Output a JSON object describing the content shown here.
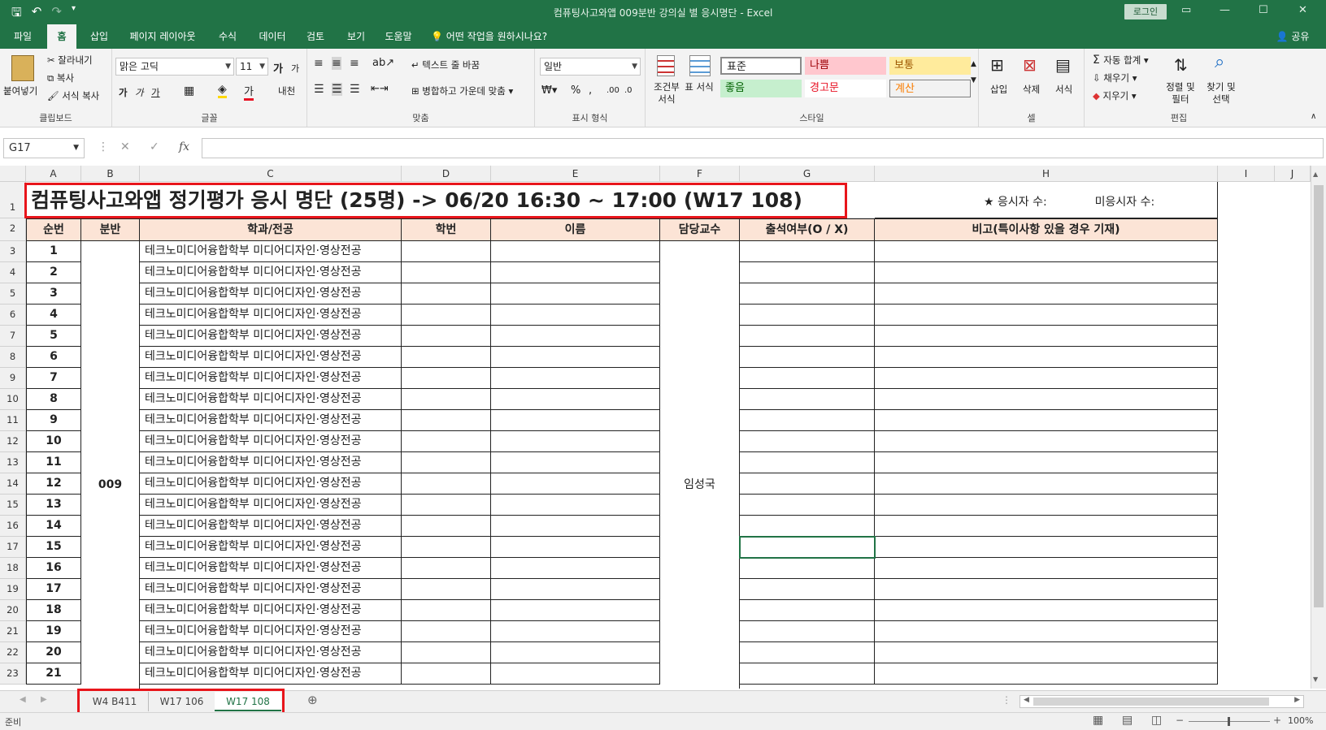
{
  "window": {
    "title": "컴퓨팅사고와앱 009분반 강의실 별 응시명단  -  Excel",
    "login_label": "로그인"
  },
  "ribbon_tabs": [
    "파일",
    "홈",
    "삽입",
    "페이지 레이아웃",
    "수식",
    "데이터",
    "검토",
    "보기",
    "도움말"
  ],
  "tell_me": "어떤 작업을 원하시나요?",
  "share_label": "공유",
  "ribbon": {
    "clipboard": {
      "paste": "붙여넣기",
      "cut": "잘라내기",
      "copy": "복사",
      "format_painter": "서식 복사",
      "label": "클립보드"
    },
    "font": {
      "name": "맑은 고딕",
      "size": "11",
      "label": "글꼴"
    },
    "alignment": {
      "wrap": "텍스트 줄 바꿈",
      "merge": "병합하고 가운데 맞춤",
      "label": "맞춤"
    },
    "number": {
      "format": "일반",
      "label": "표시 형식"
    },
    "styles": {
      "conditional": "조건부 서식",
      "table": "표 서식",
      "normal": "표준",
      "bad": "나쁨",
      "neutral": "보통",
      "good": "좋음",
      "warning": "경고문",
      "calculation": "계산",
      "label": "스타일"
    },
    "cells": {
      "insert": "삽입",
      "delete": "삭제",
      "format": "서식",
      "label": "셀"
    },
    "editing": {
      "autosum": "자동 합계",
      "fill": "채우기",
      "clear": "지우기",
      "sort": "정렬 및 필터",
      "find": "찾기 및 선택",
      "label": "편집"
    }
  },
  "formula_bar": {
    "name_box": "G17",
    "fx": "fx",
    "value": ""
  },
  "columns": [
    "A",
    "B",
    "C",
    "D",
    "E",
    "F",
    "G",
    "H",
    "I",
    "J"
  ],
  "sheet": {
    "title": "컴퓨팅사고와앱 정기평가 응시 명단 (25명) -> 06/20 16:30 ~ 17:00  (W17 108)",
    "examinees_label": "★ 응시자 수:",
    "non_examinees_label": "미응시자 수:",
    "headers": [
      "순번",
      "분반",
      "학과/전공",
      "학번",
      "이름",
      "담당교수",
      "출석여부(O / X)",
      "비고(특이사항 있을 경우 기재)"
    ],
    "section": "009",
    "professor": "임성국",
    "major": "테크노미디어융합학부 미디어디자인·영상전공",
    "row_numbers": [
      "1",
      "2",
      "3",
      "4",
      "5",
      "6",
      "7",
      "8",
      "9",
      "10",
      "11",
      "12",
      "13",
      "14",
      "15",
      "16",
      "17",
      "18",
      "19",
      "20",
      "21",
      "22",
      "23"
    ],
    "seq": [
      "1",
      "2",
      "3",
      "4",
      "5",
      "6",
      "7",
      "8",
      "9",
      "10",
      "11",
      "12",
      "13",
      "14",
      "15",
      "16",
      "17",
      "18",
      "19",
      "20",
      "21"
    ]
  },
  "sheet_tabs": [
    "W4 B411",
    "W17 106",
    "W17 108"
  ],
  "active_sheet": "W17 108",
  "status": {
    "ready": "준비",
    "zoom": "100%"
  },
  "colors": {
    "excel_green": "#217346",
    "header_fill": "#fce4d6",
    "highlight_red": "#e8151b"
  }
}
